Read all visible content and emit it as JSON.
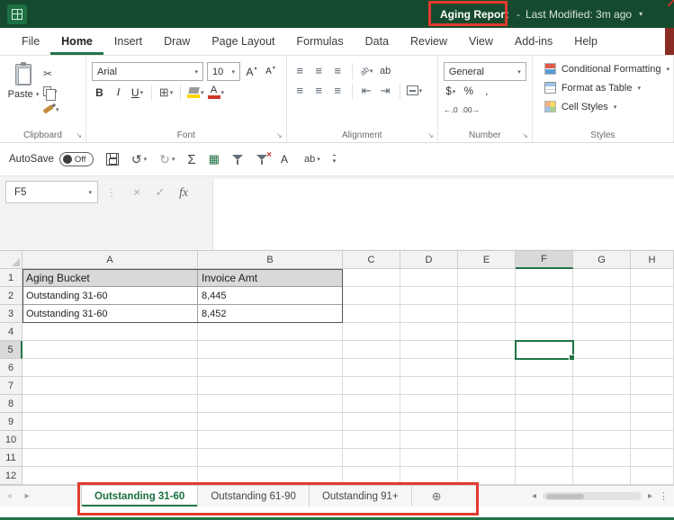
{
  "titlebar": {
    "title": "Aging Report",
    "dash": "-",
    "last_modified": "Last Modified: 3m ago"
  },
  "ribbon_tabs": {
    "items": [
      {
        "label": "File",
        "active": false
      },
      {
        "label": "Home",
        "active": true
      },
      {
        "label": "Insert",
        "active": false
      },
      {
        "label": "Draw",
        "active": false
      },
      {
        "label": "Page Layout",
        "active": false
      },
      {
        "label": "Formulas",
        "active": false
      },
      {
        "label": "Data",
        "active": false
      },
      {
        "label": "Review",
        "active": false
      },
      {
        "label": "View",
        "active": false
      },
      {
        "label": "Add-ins",
        "active": false
      },
      {
        "label": "Help",
        "active": false
      }
    ]
  },
  "ribbon": {
    "clipboard": {
      "label": "Clipboard",
      "paste_label": "Paste"
    },
    "font": {
      "label": "Font",
      "family": "Arial",
      "size": "10",
      "bold": "B",
      "italic": "I",
      "underline": "U"
    },
    "alignment": {
      "label": "Alignment"
    },
    "number": {
      "label": "Number",
      "format": "General",
      "currency": "$",
      "percent": "%",
      "comma": ","
    },
    "styles": {
      "label": "Styles",
      "conditional_formatting": "Conditional Formatting",
      "format_as_table": "Format as Table",
      "cell_styles": "Cell Styles"
    }
  },
  "quick_access": {
    "autosave_label": "AutoSave",
    "autosave_state": "Off"
  },
  "formula_bar": {
    "name_box": "F5",
    "fx": "fx"
  },
  "grid": {
    "columns": [
      "A",
      "B",
      "C",
      "D",
      "E",
      "F",
      "G",
      "H"
    ],
    "row_count": 12,
    "selected_cell": "F5",
    "selected_column": "F",
    "selected_row": "5"
  },
  "sheet_data": {
    "headers": [
      "Aging Bucket",
      "Invoice Amt"
    ],
    "rows": [
      [
        "Outstanding 31-60",
        "8,445"
      ],
      [
        "Outstanding 31-60",
        "8,452"
      ]
    ]
  },
  "sheet_tabs": {
    "tabs": [
      {
        "label": "Outstanding 31-60",
        "active": true
      },
      {
        "label": "Outstanding 61-90",
        "active": false
      },
      {
        "label": "Outstanding 91+",
        "active": false
      }
    ]
  },
  "colors": {
    "excel_green": "#217346",
    "titlebar_green": "#164a2e",
    "annotation_red": "#e23a30",
    "table_header_fill": "#d9d9d9"
  },
  "glyphs": {
    "dropdown": "▾",
    "up_triangle": "▴",
    "scissors": "✂",
    "launcher": "↘",
    "undo": "↺",
    "redo": "↻",
    "sigma": "Σ",
    "grid": "▦",
    "borders_grid": "⊞",
    "lines": "≡",
    "indent_left": "⇤",
    "indent_right": "⇥",
    "x_mark": "×",
    "check_mark": "✓",
    "vdots": "⋮",
    "prev_arrow": "◂",
    "next_arrow": "▸",
    "plus_circle": "⊕",
    "letter_a": "A",
    "ab": "ab",
    "inc_decimal": "←.0",
    "dec_decimal": ".00→"
  }
}
